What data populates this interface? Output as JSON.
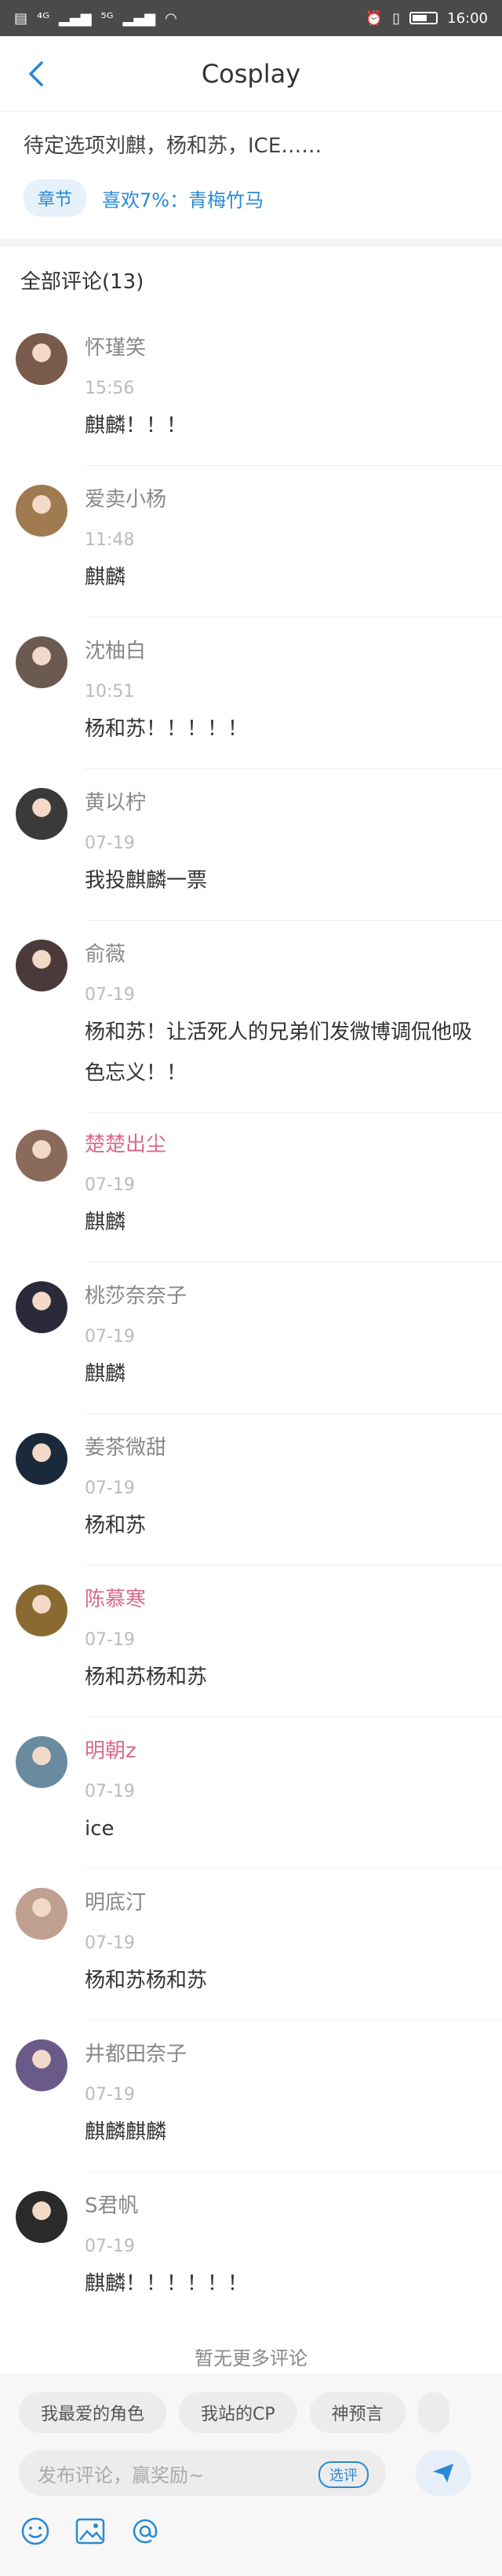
{
  "status_bar": {
    "signal_left": "⁴ᴳ",
    "signal_right": "⁵ᴳ",
    "time": "16:00"
  },
  "nav": {
    "title": "Cosplay"
  },
  "story": {
    "description": "待定选项刘麒，杨和苏，ICE……",
    "chapter_label": "章节",
    "like_text": "喜欢7%：青梅竹马"
  },
  "comments_header": "全部评论(13)",
  "comments": [
    {
      "name": "怀瑾笑",
      "time": "15:56",
      "text": "麒麟！！！",
      "name_color": "gray",
      "avatar_color": "#7a5a4a"
    },
    {
      "name": "爱卖小杨",
      "time": "11:48",
      "text": "麒麟",
      "name_color": "gray",
      "avatar_color": "#a07a50"
    },
    {
      "name": "沈柚白",
      "time": "10:51",
      "text": "杨和苏！！！！！",
      "name_color": "gray",
      "avatar_color": "#6b5a52"
    },
    {
      "name": "黄以柠",
      "time": "07-19",
      "text": "我投麒麟一票",
      "name_color": "gray",
      "avatar_color": "#3a3a3a"
    },
    {
      "name": "俞薇",
      "time": "07-19",
      "text": "杨和苏！让活死人的兄弟们发微博调侃他吸色忘义！！",
      "name_color": "gray",
      "avatar_color": "#4a3a3a"
    },
    {
      "name": "楚楚出尘",
      "time": "07-19",
      "text": "麒麟",
      "name_color": "pink",
      "avatar_color": "#8a6a5a"
    },
    {
      "name": "桃莎奈奈子",
      "time": "07-19",
      "text": "麒麟",
      "name_color": "gray",
      "avatar_color": "#2a2a3a"
    },
    {
      "name": "姜茶微甜",
      "time": "07-19",
      "text": "杨和苏",
      "name_color": "gray",
      "avatar_color": "#1a2a3a"
    },
    {
      "name": "陈慕寒",
      "time": "07-19",
      "text": "杨和苏杨和苏",
      "name_color": "pink",
      "avatar_color": "#8a6a30"
    },
    {
      "name": "明朝z",
      "time": "07-19",
      "text": "ice",
      "name_color": "pink",
      "avatar_color": "#6a8aa0"
    },
    {
      "name": "明底汀",
      "time": "07-19",
      "text": "杨和苏杨和苏",
      "name_color": "gray",
      "avatar_color": "#c0a090"
    },
    {
      "name": "井都田奈子",
      "time": "07-19",
      "text": "麒麟麒麟",
      "name_color": "gray",
      "avatar_color": "#6a5a8a"
    },
    {
      "name": "S君帆",
      "time": "07-19",
      "text": "麒麟！！！！！！",
      "name_color": "gray",
      "avatar_color": "#2a2a2a"
    }
  ],
  "no_more_text": "暂无更多评论",
  "quick_tags": [
    "我最爱的角色",
    "我站的CP",
    "神预言",
    ""
  ],
  "input": {
    "placeholder": "发布评论，赢奖励~",
    "sticker_label": "选评"
  },
  "tools": [
    "emoji-icon",
    "image-icon",
    "mention-icon"
  ]
}
